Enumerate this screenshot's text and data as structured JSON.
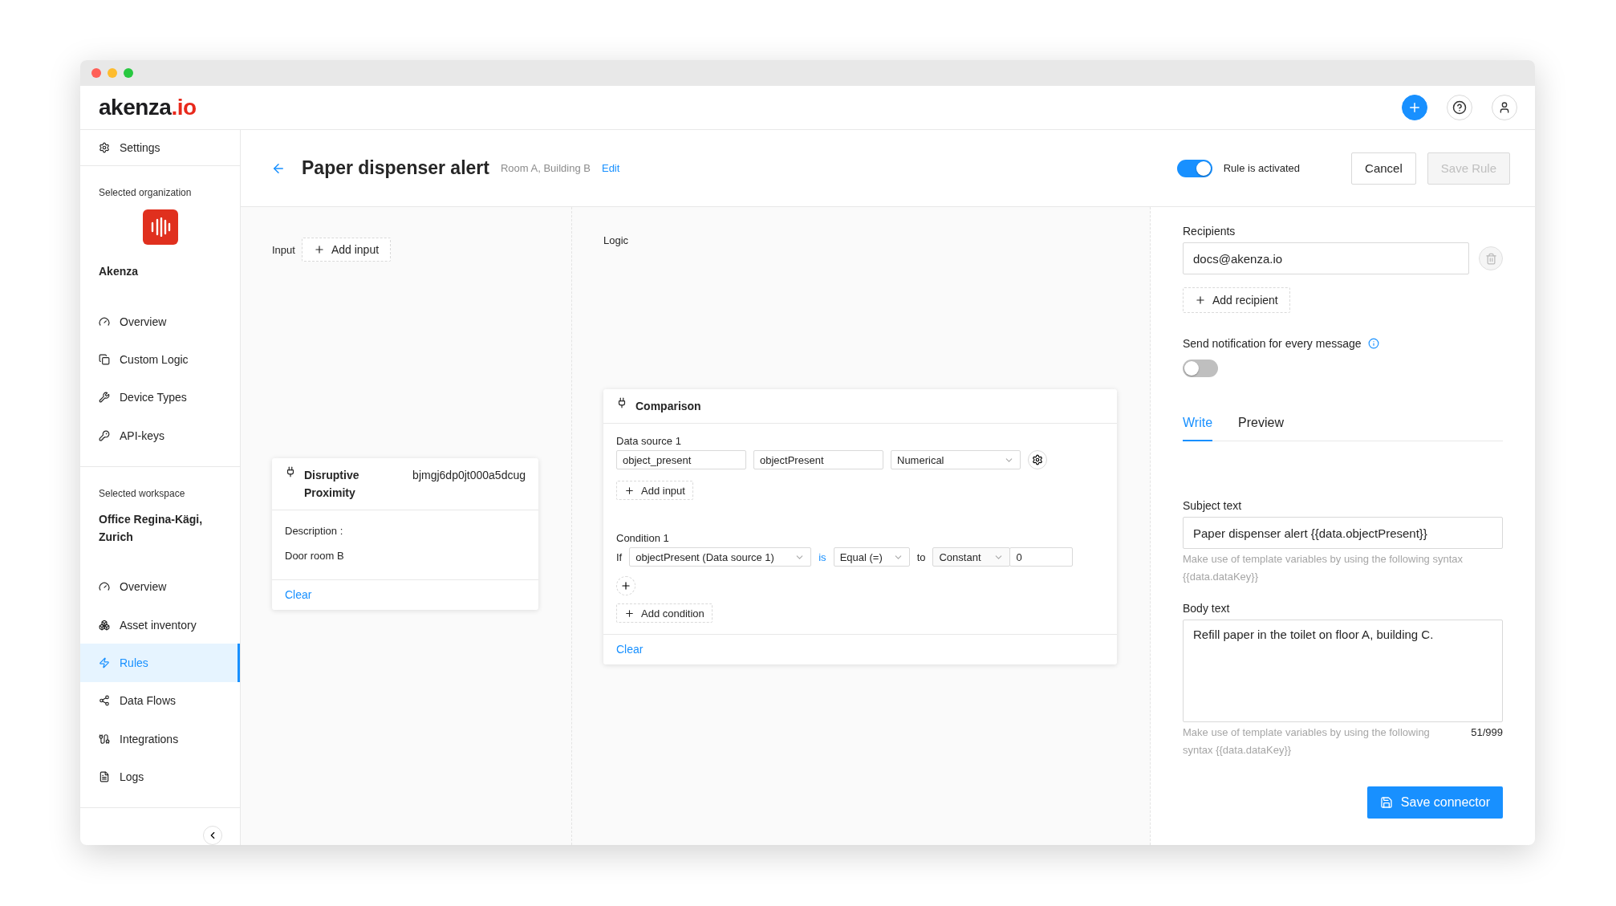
{
  "logo": {
    "name": "akenza",
    "suffix": ".io"
  },
  "sidebar": {
    "settings": "Settings",
    "org_heading": "Selected organization",
    "org_name": "Akenza",
    "org_items": [
      {
        "label": "Overview",
        "selected": false
      },
      {
        "label": "Custom Logic",
        "selected": false
      },
      {
        "label": "Device Types",
        "selected": false
      },
      {
        "label": "API-keys",
        "selected": false
      }
    ],
    "workspace_heading": "Selected workspace",
    "workspace_name": "Office Regina-Kägi, Zurich",
    "workspace_items": [
      {
        "label": "Overview",
        "selected": false
      },
      {
        "label": "Asset inventory",
        "selected": false
      },
      {
        "label": "Rules",
        "selected": true
      },
      {
        "label": "Data Flows",
        "selected": false
      },
      {
        "label": "Integrations",
        "selected": false
      },
      {
        "label": "Logs",
        "selected": false
      }
    ]
  },
  "page_header": {
    "title": "Paper dispenser alert",
    "subtitle": "Room A, Building B",
    "edit": "Edit",
    "activation": {
      "label": "Rule is activated",
      "on": true
    },
    "cancel": "Cancel",
    "save": {
      "label": "Save Rule",
      "disabled": true
    }
  },
  "input_column": {
    "label": "Input",
    "add_button": "Add input",
    "card": {
      "title": "Disruptive Proximity",
      "device_id": "bjmgj6dp0jt000a5dcug",
      "description_label": "Description :",
      "description": "Door room B",
      "clear": "Clear"
    }
  },
  "logic_column": {
    "label": "Logic",
    "card": {
      "title": "Comparison",
      "data_source_label": "Data source 1",
      "fields": [
        "object_present",
        "objectPresent"
      ],
      "type_select": "Numerical",
      "add_input": "Add input",
      "condition_label": "Condition 1",
      "if_label": "If",
      "operand": "objectPresent (Data source 1)",
      "is_label": "is",
      "operator": "Equal (=)",
      "to_label": "to",
      "value_type": "Constant",
      "value": "0",
      "add_condition": "Add condition",
      "clear": "Clear"
    }
  },
  "right_panel": {
    "recipients_label": "Recipients",
    "recipients": [
      "docs@akenza.io"
    ],
    "add_recipient": "Add recipient",
    "notify_label": "Send notification for every message",
    "notify_toggle": {
      "on": false
    },
    "tabs": [
      {
        "label": "Write",
        "selected": true
      },
      {
        "label": "Preview",
        "selected": false
      }
    ],
    "subject_label": "Subject text",
    "subject_value": "Paper dispenser alert {{data.objectPresent}}",
    "subject_hint": "Make use of template variables by using the following syntax {{data.dataKey}}",
    "body_label": "Body text",
    "body_value": "Refill paper in the toilet on floor A, building C.",
    "body_hint": "Make use of template variables by using the following syntax {{data.dataKey}}",
    "body_count": "51/999",
    "save_button": "Save connector"
  }
}
